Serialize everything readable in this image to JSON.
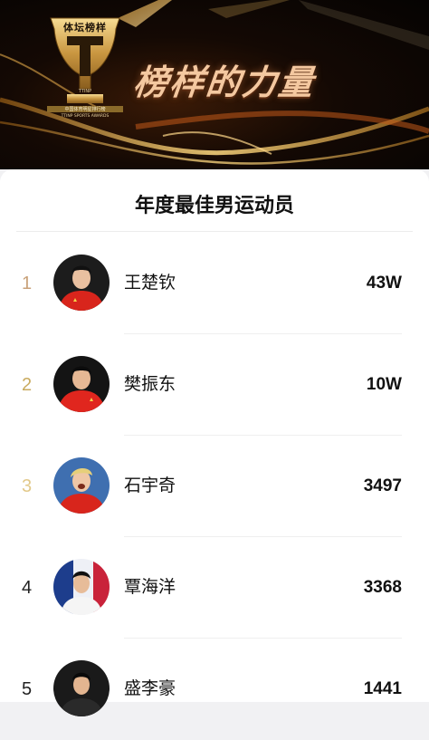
{
  "banner": {
    "logo_text": "体坛榜样",
    "logo_ttinp": "TTINP",
    "logo_sub1": "中国体育明星排行榜",
    "logo_sub2": "TTINP SPORTS AWARDS",
    "title": "榜样的力量"
  },
  "section": {
    "title": "年度最佳男运动员"
  },
  "ranking": [
    {
      "rank": "1",
      "name": "王楚钦",
      "score": "43W"
    },
    {
      "rank": "2",
      "name": "樊振东",
      "score": "10W"
    },
    {
      "rank": "3",
      "name": "石宇奇",
      "score": "3497"
    },
    {
      "rank": "4",
      "name": "覃海洋",
      "score": "3368"
    },
    {
      "rank": "5",
      "name": "盛李豪",
      "score": "1441"
    }
  ],
  "colors": {
    "rank_1": "#c9a27a",
    "rank_2": "#c9ab5f",
    "rank_3": "#e2c98a",
    "rank_other": "#222222",
    "gold": "#d8a850"
  },
  "icons": {
    "logo": "trophy-t-logo-icon",
    "avatars": [
      "athlete-avatar-red-jersey",
      "athlete-avatar-red-jersey",
      "athlete-avatar-red-jersey",
      "athlete-avatar-swimsuit",
      "athlete-avatar-dark"
    ]
  }
}
